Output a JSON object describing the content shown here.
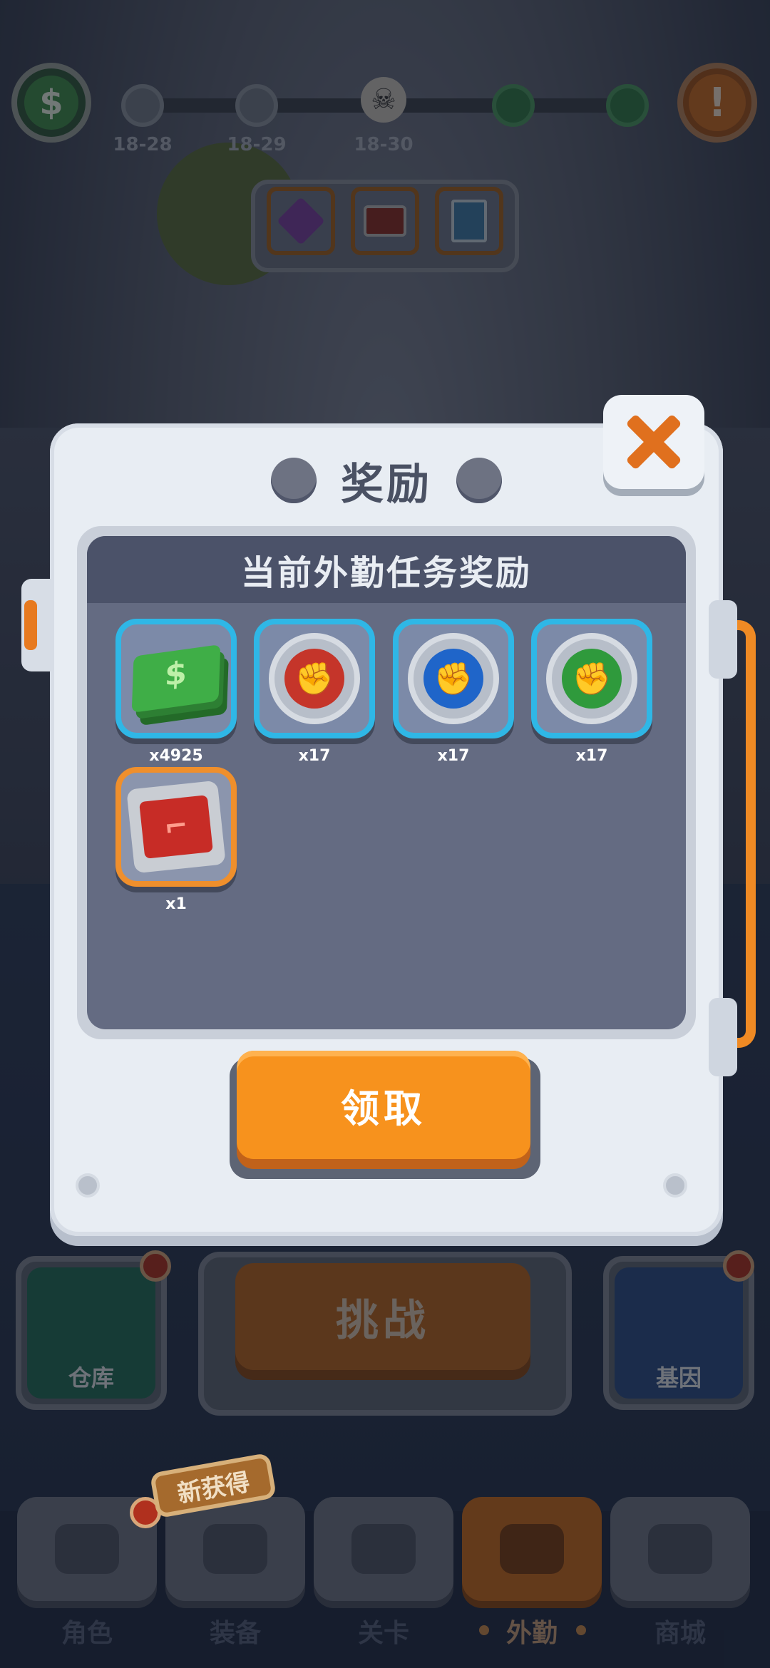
{
  "header": {
    "cash_icon": "cash-plus-icon",
    "alert_icon": "exclamation-icon",
    "stages": [
      {
        "label": "18-28",
        "state": "locked"
      },
      {
        "label": "18-29",
        "state": "locked"
      },
      {
        "label": "18-30",
        "state": "boss"
      }
    ],
    "preview_items": [
      "gem-icon",
      "chip-icon",
      "blueprint-icon"
    ]
  },
  "modal": {
    "title": "奖励",
    "panel_title": "当前外勤任务奖励",
    "rewards": [
      {
        "icon": "cash-stack-icon",
        "qty": "x4925",
        "frame_color": "#2fb7e6"
      },
      {
        "icon": "red-fist-coin-icon",
        "qty": "x17",
        "frame_color": "#2fb7e6"
      },
      {
        "icon": "blue-fist-coin-icon",
        "qty": "x17",
        "frame_color": "#2fb7e6"
      },
      {
        "icon": "green-fist-coin-icon",
        "qty": "x17",
        "frame_color": "#2fb7e6"
      },
      {
        "icon": "red-chip-icon",
        "qty": "x1",
        "frame_color": "#ef8f2c"
      }
    ],
    "claim_label": "领取",
    "close_icon": "close-icon"
  },
  "hud": {
    "warehouse_label": "仓库",
    "challenge_label": "挑战",
    "gene_label": "基因"
  },
  "nav": {
    "new_badge": "新获得",
    "tabs": [
      {
        "label": "角色",
        "icon": "skull-icon",
        "active": false
      },
      {
        "label": "装备",
        "icon": "gun-icon",
        "active": false
      },
      {
        "label": "关卡",
        "icon": "map-pin-icon",
        "active": false
      },
      {
        "label": "外勤",
        "icon": "field-icon",
        "active": true
      },
      {
        "label": "商城",
        "icon": "shop-icon",
        "active": false
      }
    ]
  },
  "colors": {
    "accent_orange": "#f7921d",
    "rare_frame_blue": "#2fb7e6",
    "epic_frame_orange": "#ef8f2c"
  }
}
